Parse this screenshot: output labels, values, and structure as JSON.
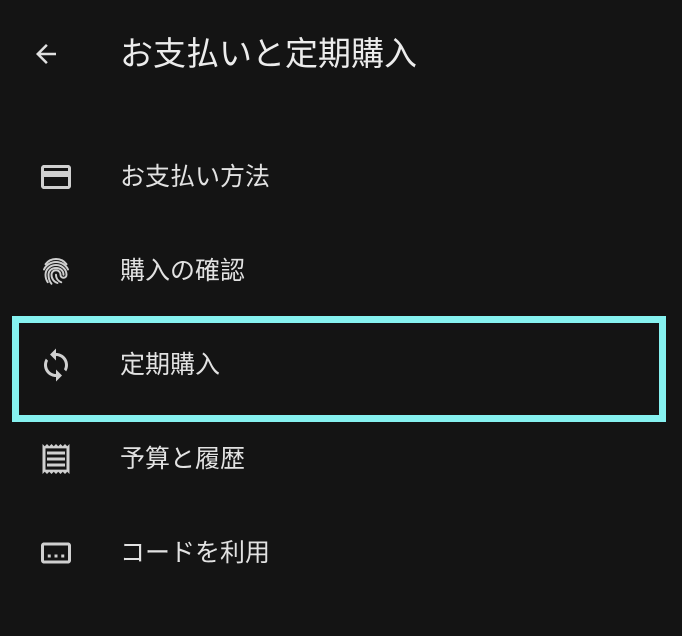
{
  "header": {
    "title": "お支払いと定期購入",
    "back_icon": "arrow-back-icon"
  },
  "menu": {
    "items": [
      {
        "label": "お支払い方法",
        "icon": "credit-card-icon"
      },
      {
        "label": "購入の確認",
        "icon": "fingerprint-icon"
      },
      {
        "label": "定期購入",
        "icon": "sync-icon"
      },
      {
        "label": "予算と履歴",
        "icon": "receipt-icon"
      },
      {
        "label": "コードを利用",
        "icon": "redeem-code-icon"
      }
    ]
  },
  "colors": {
    "background": "#141414",
    "text": "#e2e2e2",
    "icon": "#d0d0d0",
    "highlight": "#86f2f0"
  }
}
